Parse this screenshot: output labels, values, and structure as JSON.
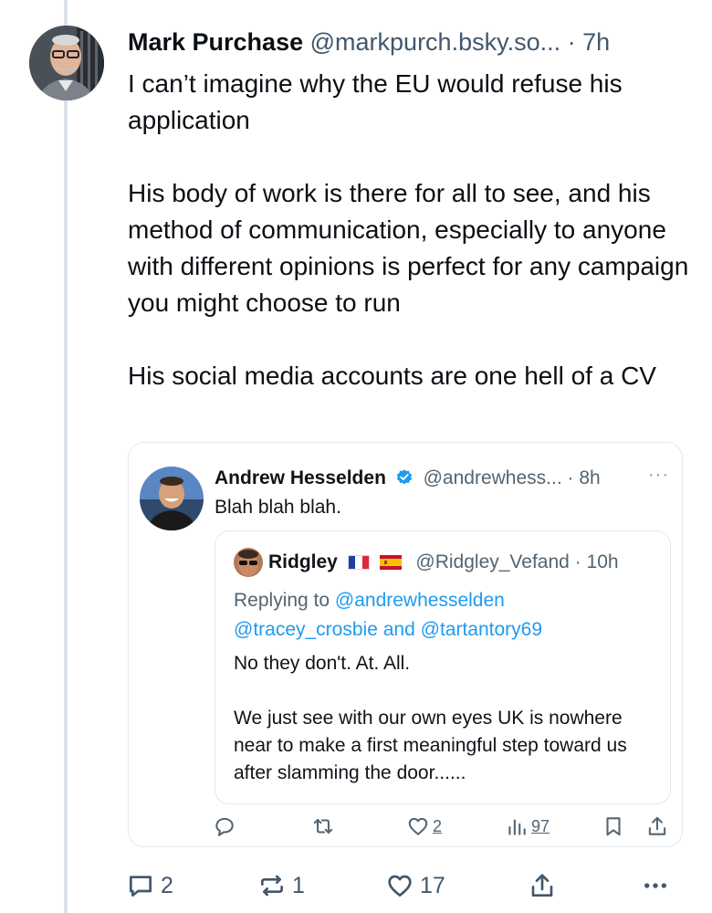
{
  "post": {
    "author_name": "Mark Purchase",
    "author_handle": "@markpurch.bsky.so...",
    "separator": "·",
    "time": "7h",
    "paragraphs": [
      "I can’t imagine why the EU would refuse his application",
      "His body of work is there for all to see, and his method of communication, especially to anyone with different opinions is perfect for any campaign you might choose to run",
      "His social media accounts are one hell of a CV"
    ],
    "actions": {
      "reply_count": "2",
      "repost_count": "1",
      "like_count": "17"
    }
  },
  "embed": {
    "author_name": "Andrew Hesselden",
    "author_handle": "@andrewhess...",
    "separator": "·",
    "time": "8h",
    "more": "···",
    "text": "Blah blah blah.",
    "quoted": {
      "author_name": "Ridgley",
      "author_handle": "@Ridgley_Vefand",
      "separator": "·",
      "time": "10h",
      "replying_prefix": "Replying to",
      "mention_1": "@andrewhesselden",
      "mention_2": "@tracey_crosbie",
      "and_word": "and",
      "mention_3": "@tartantory69",
      "paragraphs": [
        "No they don't. At. All.",
        "We just see with our own eyes UK is nowhere near to make a first meaningful step toward us after slamming the door......"
      ]
    },
    "actions": {
      "like_count": "2",
      "views_count": "97"
    }
  },
  "colors": {
    "text": "#0b0f14",
    "secondary": "#42576c",
    "link": "#1d9bf0",
    "verified": "#1d9bf0",
    "thread_line": "#dde3ea"
  }
}
